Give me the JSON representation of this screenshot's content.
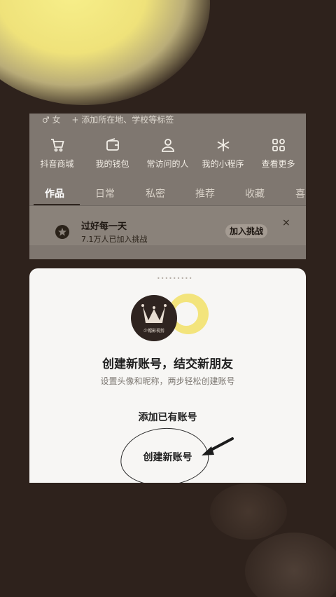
{
  "profile": {
    "tagline_prefix": "♂ 女",
    "tagline_add": "+ 添加所在地、学校等标签",
    "shortcuts": [
      {
        "label": "抖音商城",
        "icon": "cart-icon"
      },
      {
        "label": "我的钱包",
        "icon": "wallet-icon"
      },
      {
        "label": "常访问的人",
        "icon": "person-icon"
      },
      {
        "label": "我的小程序",
        "icon": "asterisk-icon"
      },
      {
        "label": "查看更多",
        "icon": "grid-icon"
      }
    ],
    "tabs": [
      "作品",
      "日常",
      "私密",
      "推荐",
      "收藏",
      "喜"
    ],
    "active_tab": "作品",
    "challenge": {
      "title": "过好每一天",
      "subtitle": "7.1万人已加入挑战",
      "button": "加入挑战",
      "close": "×"
    }
  },
  "sheet": {
    "handle": "•••••••••",
    "avatar_text": "少帽影视剪",
    "title": "创建新账号，结交新朋友",
    "subtitle": "设置头像和昵称，两步轻松创建账号",
    "add_existing": "添加已有账号",
    "create_new": "创建新账号"
  },
  "colors": {
    "background": "#2e221c",
    "glow": "#f7ef8a",
    "sheet": "#f7f6f4",
    "dim_page": "#7f7770"
  }
}
